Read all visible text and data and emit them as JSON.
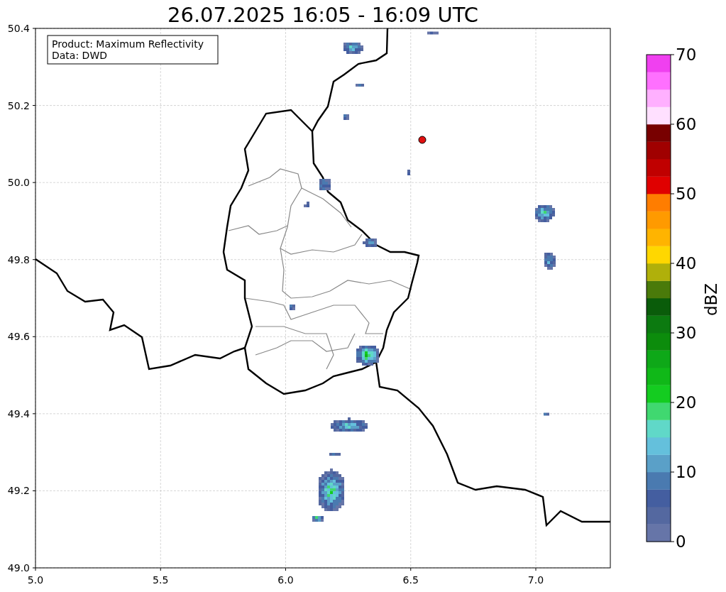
{
  "title": "26.07.2025 16:05 - 16:09 UTC",
  "info_box": [
    "Product: Maximum Reflectivity",
    "Data: DWD"
  ],
  "map": {
    "x_ticks": [
      "5.0",
      "5.5",
      "6.0",
      "6.5",
      "7.0"
    ],
    "y_ticks": [
      "50.4",
      "50.2",
      "50.0",
      "49.8",
      "49.6",
      "49.4",
      "49.2",
      "49.0"
    ]
  },
  "colorbar": {
    "label": "dBZ",
    "ticks": [
      "70",
      "60",
      "50",
      "40",
      "30",
      "20",
      "10",
      "0"
    ],
    "segments": [
      {
        "color": "#6675a8"
      },
      {
        "color": "#5468a0"
      },
      {
        "color": "#445ea0"
      },
      {
        "color": "#4a7ab0"
      },
      {
        "color": "#5aa0c8"
      },
      {
        "color": "#64c0dc"
      },
      {
        "color": "#60d8c8"
      },
      {
        "color": "#40d870"
      },
      {
        "color": "#14cc20"
      },
      {
        "color": "#10b818"
      },
      {
        "color": "#0ea818"
      },
      {
        "color": "#0c8c0c"
      },
      {
        "color": "#0c7a10"
      },
      {
        "color": "#0a5c0a"
      },
      {
        "color": "#4a7a0a"
      },
      {
        "color": "#b0b00a"
      },
      {
        "color": "#ffd700"
      },
      {
        "color": "#ffb400"
      },
      {
        "color": "#ff9a00"
      },
      {
        "color": "#ff7d00"
      },
      {
        "color": "#e00000"
      },
      {
        "color": "#c00000"
      },
      {
        "color": "#a00000"
      },
      {
        "color": "#780000"
      },
      {
        "color": "#ffe0ff"
      },
      {
        "color": "#ffb0ff"
      },
      {
        "color": "#ff70ff"
      },
      {
        "color": "#f040f0"
      }
    ]
  }
}
